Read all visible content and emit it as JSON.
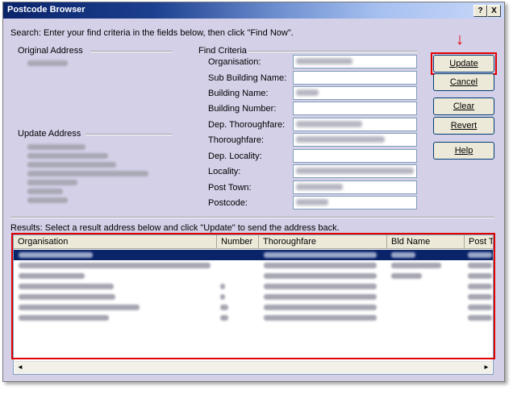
{
  "window": {
    "title": "Postcode Browser",
    "help_btn": "?",
    "close_btn": "X"
  },
  "instructions": "Search: Enter your find criteria in the fields below, then click \"Find Now\".",
  "original_address": {
    "heading": "Original Address"
  },
  "update_address": {
    "heading": "Update Address"
  },
  "find_criteria": {
    "heading": "Find Criteria",
    "fields": [
      {
        "label": "Organisation:"
      },
      {
        "label": "Sub Building Name:"
      },
      {
        "label": "Building Name:"
      },
      {
        "label": "Building Number:"
      },
      {
        "label": "Dep. Thoroughfare:"
      },
      {
        "label": "Thoroughfare:"
      },
      {
        "label": "Dep. Locality:"
      },
      {
        "label": "Locality:"
      },
      {
        "label": "Post Town:"
      },
      {
        "label": "Postcode:"
      }
    ]
  },
  "buttons": {
    "update": "Update",
    "cancel": "Cancel",
    "clear": "Clear",
    "revert": "Revert",
    "help": "Help"
  },
  "results": {
    "instructions": "Results: Select a result address below and click \"Update\" to send the address back.",
    "columns": [
      "Organisation",
      "Number",
      "Thoroughfare",
      "Bld Name",
      "Post T"
    ],
    "selected_row": 0,
    "scroll_left": "◄",
    "scroll_right": "►"
  },
  "annotation": {
    "arrow": "↓",
    "color": "#e00000"
  }
}
